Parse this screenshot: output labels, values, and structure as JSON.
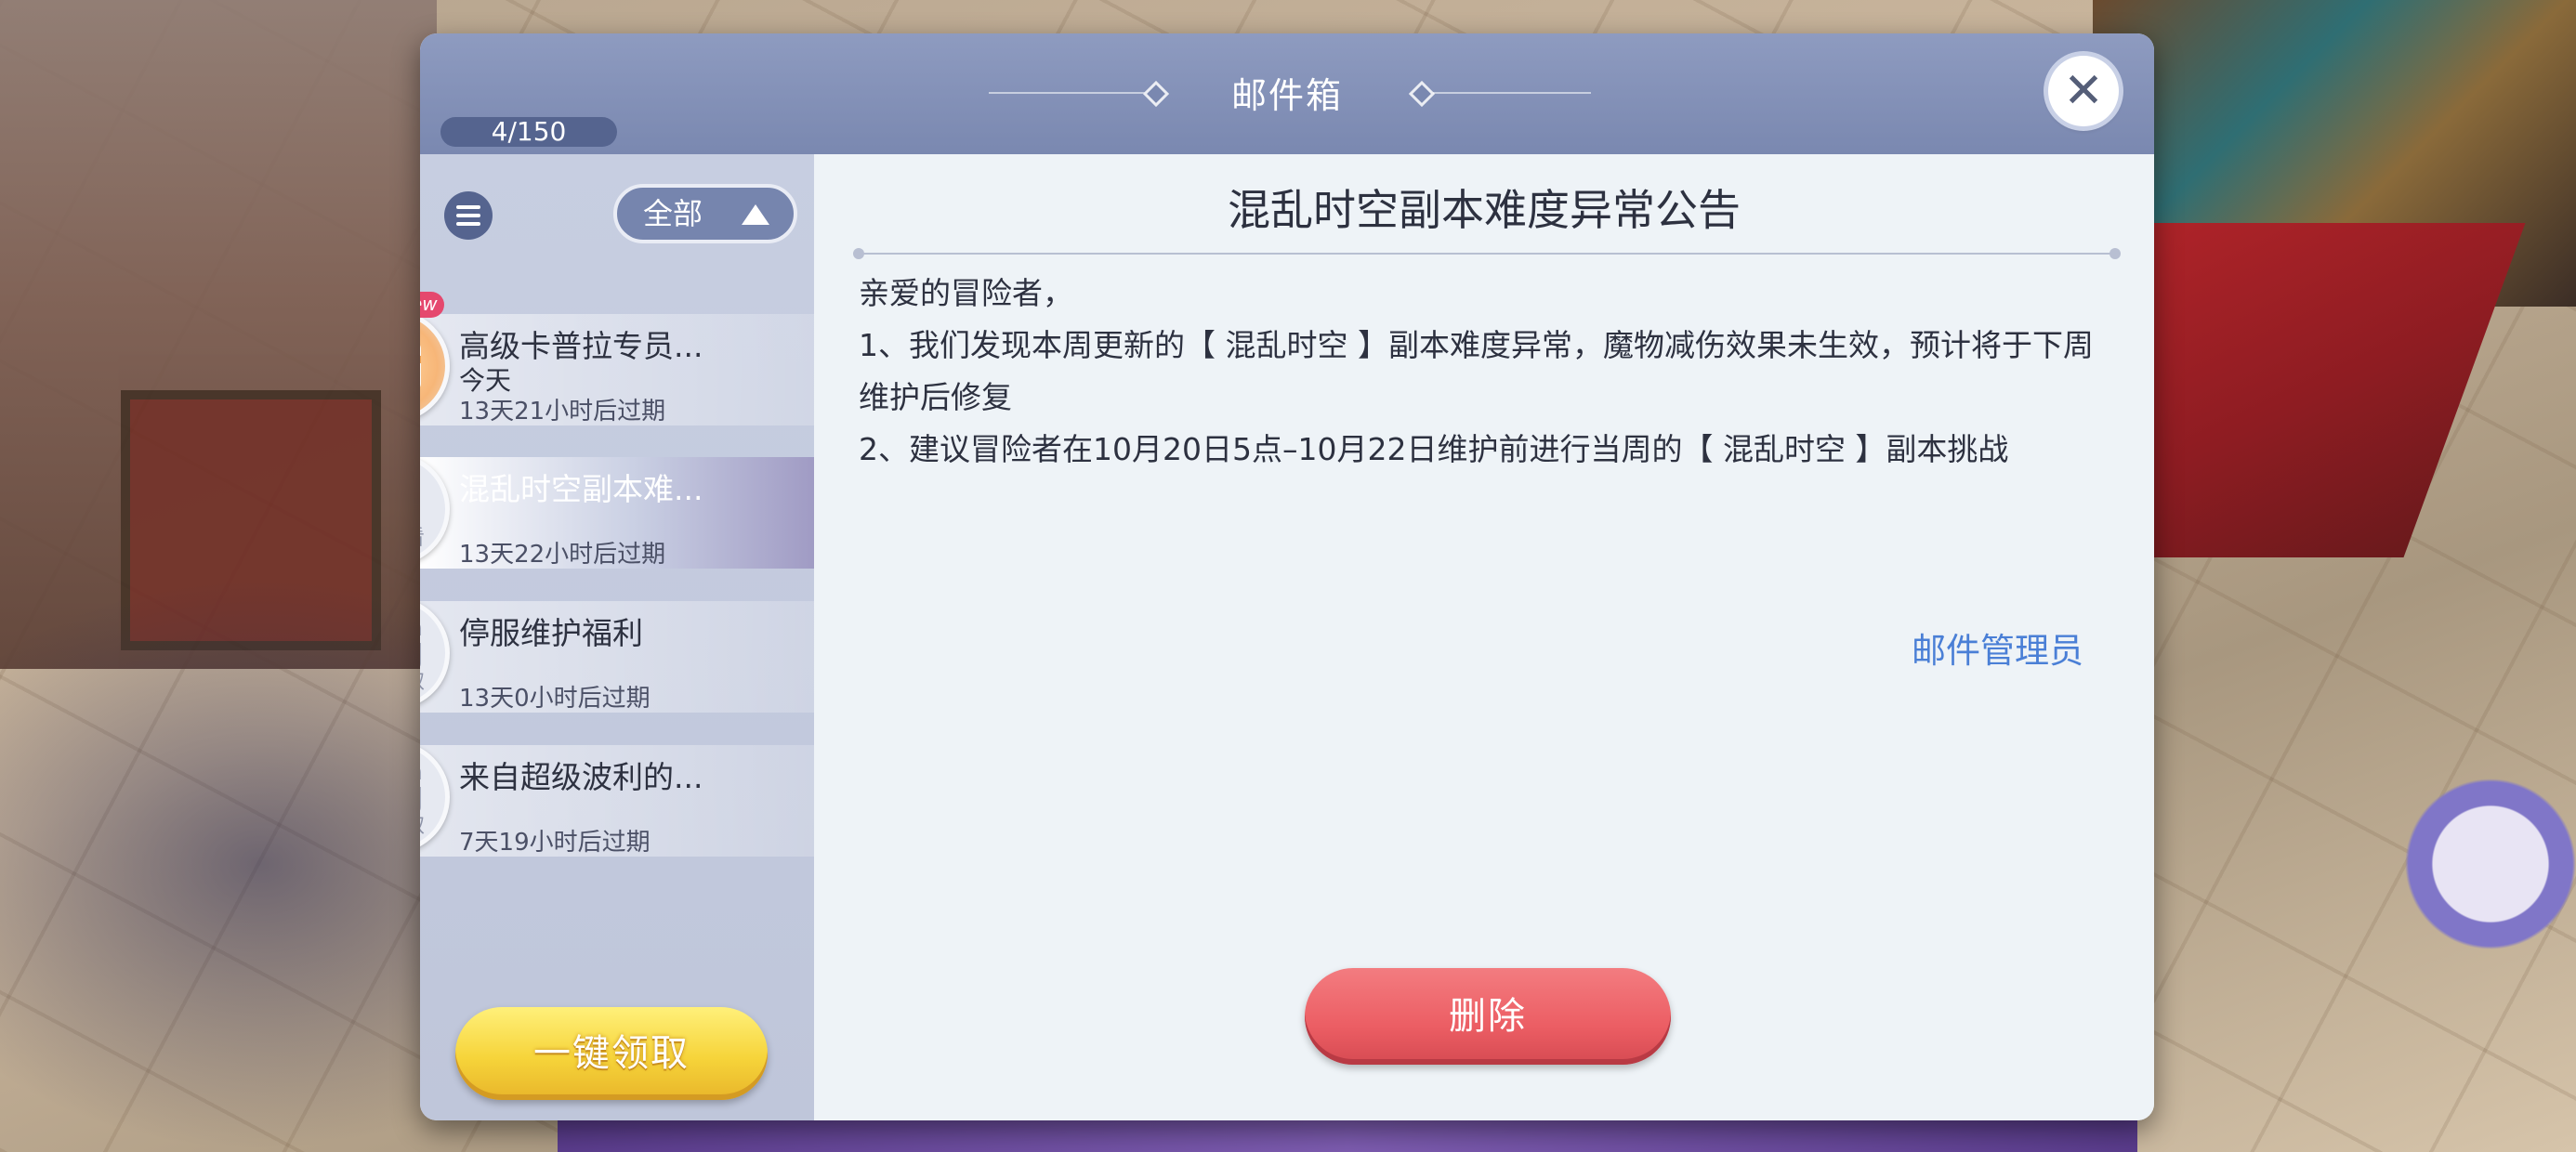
{
  "window": {
    "title": "邮件箱",
    "mail_count": "4/150",
    "close_icon": "close-icon"
  },
  "sidebar": {
    "filter_label": "全部",
    "filter_icon": "triangle-up-icon",
    "list_icon": "list-icon",
    "items": [
      {
        "title": "高级卡普拉专员...",
        "date": "今天",
        "expire": "13天21小时后过期",
        "state": "",
        "badge": "new",
        "icon": "gift-icon"
      },
      {
        "title": "混乱时空副本难...",
        "date": "",
        "expire": "13天22小时后过期",
        "state": "已查看",
        "badge": "",
        "icon": "letter-icon"
      },
      {
        "title": "停服维护福利",
        "date": "",
        "expire": "13天0小时后过期",
        "state": "已领取",
        "badge": "",
        "icon": "gift-icon"
      },
      {
        "title": "来自超级波利的...",
        "date": "",
        "expire": "7天19小时后过期",
        "state": "已领取",
        "badge": "",
        "icon": "gift-icon"
      }
    ],
    "claim_all_label": "一键领取"
  },
  "mail": {
    "title": "混乱时空副本难度异常公告",
    "greeting": "亲爱的冒险者，",
    "line1": "1、我们发现本周更新的【 混乱时空 】副本难度异常，魔物减伤效果未生效，预计将于下周维护后修复",
    "line2": "2、建议冒险者在10月20日5点–10月22日维护前进行当周的【 混乱时空 】副本挑战",
    "sender": "邮件管理员",
    "delete_label": "删除"
  }
}
